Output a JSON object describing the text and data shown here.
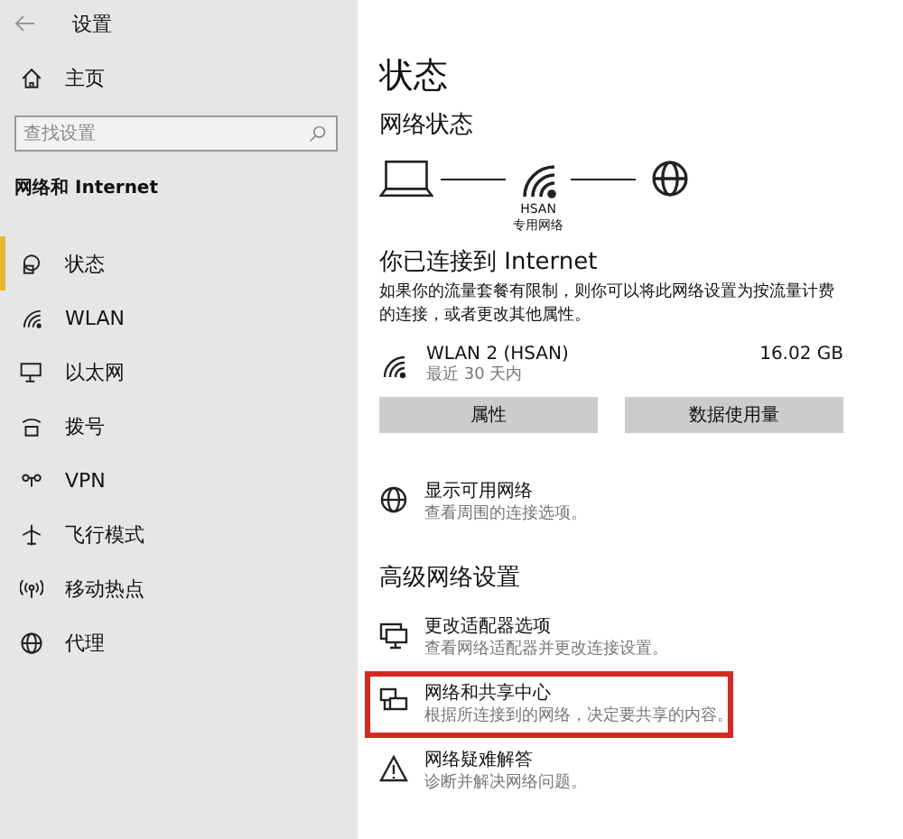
{
  "window": {
    "title": "设置"
  },
  "sidebar": {
    "home": "主页",
    "search": {
      "placeholder": "查找设置"
    },
    "section": "网络和 Internet",
    "items": [
      {
        "label": "状态",
        "kind": "status",
        "selected": true
      },
      {
        "label": "WLAN",
        "kind": "wifi",
        "selected": false
      },
      {
        "label": "以太网",
        "kind": "ethernet",
        "selected": false
      },
      {
        "label": "拨号",
        "kind": "dialup",
        "selected": false
      },
      {
        "label": "VPN",
        "kind": "vpn",
        "selected": false
      },
      {
        "label": "飞行模式",
        "kind": "plane",
        "selected": false
      },
      {
        "label": "移动热点",
        "kind": "hotspot",
        "selected": false
      },
      {
        "label": "代理",
        "kind": "globe",
        "selected": false
      }
    ]
  },
  "main": {
    "title": "状态",
    "network_status": {
      "heading": "网络状态",
      "network_name": "HSAN",
      "network_type": "专用网络"
    },
    "connected": {
      "heading": "你已连接到 Internet",
      "description": "如果你的流量套餐有限制，则你可以将此网络设置为按流量计费的连接，或者更改其他属性。"
    },
    "usage": {
      "name": "WLAN 2 (HSAN)",
      "period": "最近 30 天内",
      "amount": "16.02 GB"
    },
    "buttons": [
      "属性",
      "数据使用量"
    ],
    "show_networks": {
      "title": "显示可用网络",
      "subtitle": "查看周围的连接选项。"
    },
    "advanced_heading": "高级网络设置",
    "advanced": [
      {
        "kind": "adapter",
        "title": "更改适配器选项",
        "subtitle": "查看网络适配器并更改连接设置。",
        "highlighted": false
      },
      {
        "kind": "sharing",
        "title": "网络和共享中心",
        "subtitle": "根据所连接到的网络，决定要共享的内容。",
        "highlighted": true
      },
      {
        "kind": "warning",
        "title": "网络疑难解答",
        "subtitle": "诊断并解决网络问题。",
        "highlighted": false
      }
    ]
  }
}
